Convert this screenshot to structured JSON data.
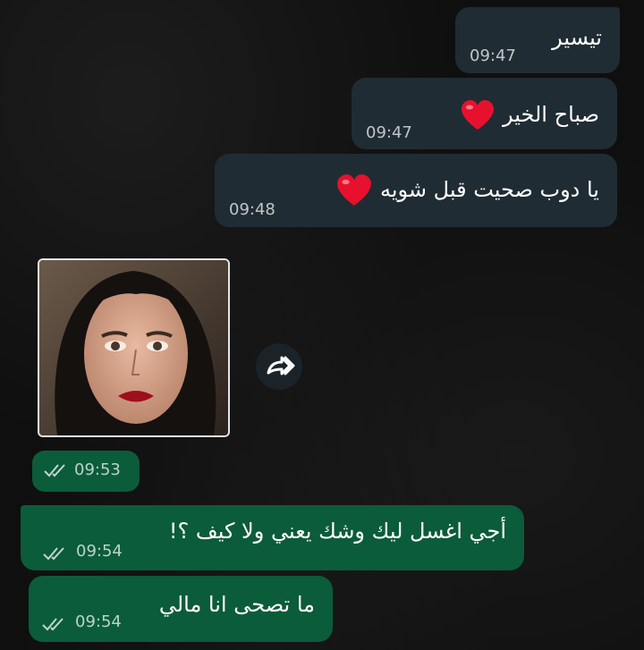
{
  "messages": [
    {
      "direction": "incoming",
      "text": "تيسير",
      "time": "09:47"
    },
    {
      "direction": "incoming",
      "text": "صباح الخير",
      "emoji": "heart",
      "time": "09:47"
    },
    {
      "direction": "incoming",
      "text": "يا دوب صحيت قبل شويه",
      "emoji": "heart",
      "time": "09:48"
    },
    {
      "direction": "outgoing",
      "type": "image",
      "time": "09:53",
      "status": "read"
    },
    {
      "direction": "outgoing",
      "text": "أجي اغسل ليك وشك يعني ولا كيف ؟!",
      "time": "09:54",
      "status": "read"
    },
    {
      "direction": "outgoing",
      "text": "ما تصحى انا مالي",
      "time": "09:54",
      "status": "read"
    }
  ],
  "icons": {
    "forward": "forward-icon",
    "heart": "heart-icon",
    "ticks": "double-check-icon"
  },
  "colors": {
    "incoming_bubble": "#202c33",
    "outgoing_bubble": "#0b5c3a",
    "heart": "#e8112d",
    "background": "#0f0f0f"
  }
}
